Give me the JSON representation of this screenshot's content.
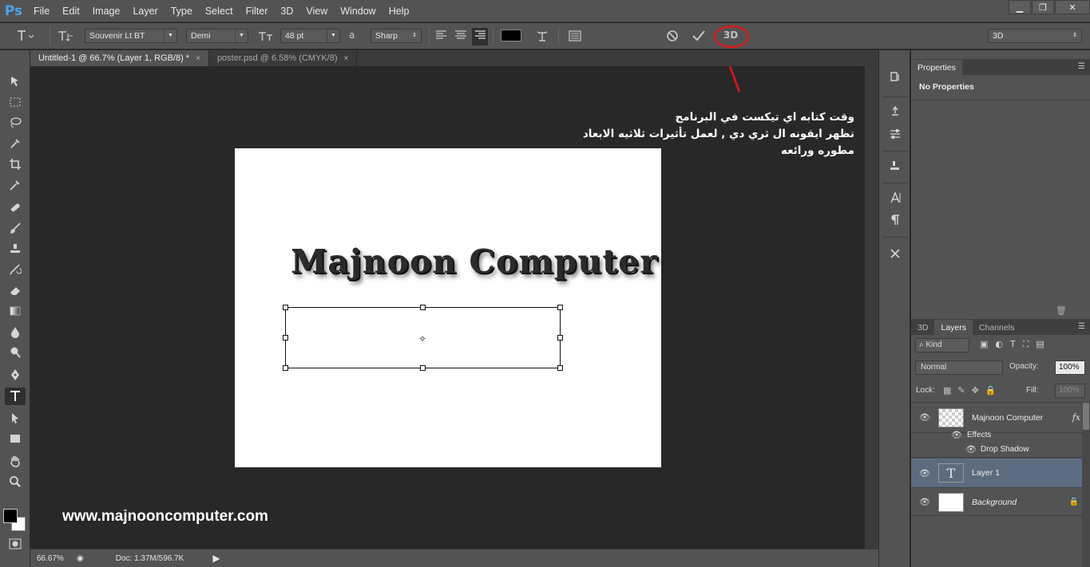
{
  "app": {
    "logo": "Ps"
  },
  "menu": [
    "File",
    "Edit",
    "Image",
    "Layer",
    "Type",
    "Select",
    "Filter",
    "3D",
    "View",
    "Window",
    "Help"
  ],
  "window_controls": {
    "minimize": "▁",
    "restore": "❐",
    "close": "✕"
  },
  "options": {
    "font_family": "Souvenir Lt BT",
    "font_style": "Demi",
    "font_size": "48 pt",
    "aa_icon": "a",
    "antialias": "Sharp",
    "workspace": "3D",
    "btn_3d": "3D",
    "text_color": "#000000"
  },
  "tabs": [
    {
      "label": "Untitled-1 @ 66.7% (Layer 1, RGB/8) *",
      "close": "×",
      "active": true
    },
    {
      "label": "poster.psd @ 6.58% (CMYK/8)",
      "close": "×",
      "active": false
    }
  ],
  "canvas": {
    "headline": "Majnoon Computer",
    "annotation_lines": [
      "وقت كتابه اي تيكست في البرنامج",
      "تظهر ايقونه ال ثري دي , لعمل تأثيرات ثلاثيه الابعاد",
      "مطوره ورائعه"
    ],
    "website": "www.majnooncomputer.com",
    "annotation_color": "#e0141b"
  },
  "status": {
    "zoom": "66.67%",
    "doc": "Doc: 1.37M/596.7K"
  },
  "properties": {
    "tab": "Properties",
    "text": "No Properties"
  },
  "layers_panel": {
    "tabs": [
      "3D",
      "Layers",
      "Channels"
    ],
    "kind": "Kind",
    "blend": "Normal",
    "opacity_label": "Opacity:",
    "opacity": "100%",
    "lock_label": "Lock:",
    "fill_label": "Fill:",
    "fill": "100%",
    "layers": [
      {
        "name": "Majnoon Computer",
        "fx": "fx"
      },
      {
        "name": "Effects"
      },
      {
        "name": "Drop Shadow"
      },
      {
        "name": "Layer 1",
        "thumb": "T"
      },
      {
        "name": "Background"
      }
    ]
  },
  "icons": {
    "cancel": "cancel-icon",
    "commit": "commit-check-icon",
    "text_3d": "3d-icon"
  }
}
